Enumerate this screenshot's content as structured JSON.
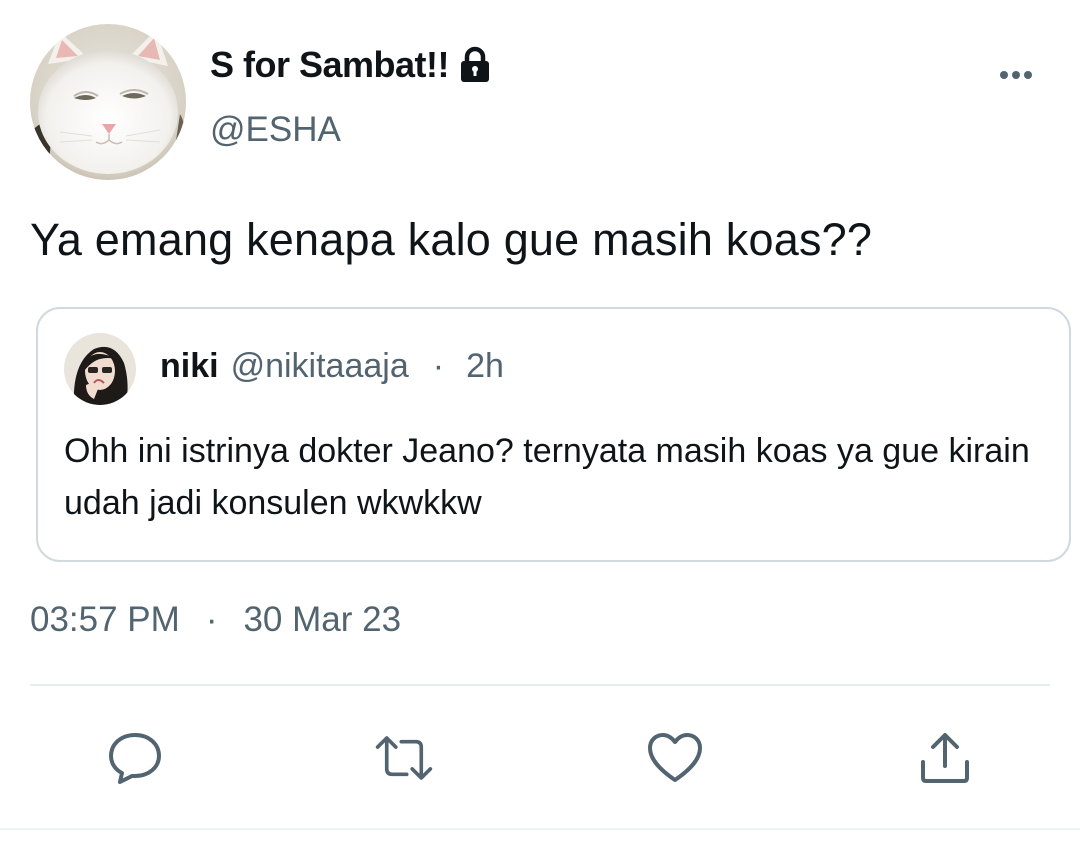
{
  "author": {
    "display_name": "S for Sambat!!",
    "handle": "@ESHA",
    "avatar_icon": "white-cat-avatar",
    "protected_icon": "lock-icon"
  },
  "tweet": {
    "text": "Ya emang kenapa kalo gue masih koas??",
    "time": "03:57 PM",
    "separator": "·",
    "date": "30 Mar 23"
  },
  "quoted_tweet": {
    "display_name": "niki",
    "handle": "@nikitaaaja",
    "separator": "·",
    "age": "2h",
    "text": "Ohh ini istrinya dokter Jeano? ternyata masih koas ya gue kirain udah jadi konsulen wkwkkw",
    "avatar_icon": "profile-photo-avatar"
  },
  "actions": {
    "reply_icon": "reply-icon",
    "retweet_icon": "retweet-icon",
    "like_icon": "heart-icon",
    "share_icon": "share-icon",
    "more_icon": "more-options-icon"
  },
  "colors": {
    "text_primary": "#0f1419",
    "text_secondary": "#536471",
    "border": "#cfd9de",
    "icon": "#536471"
  }
}
